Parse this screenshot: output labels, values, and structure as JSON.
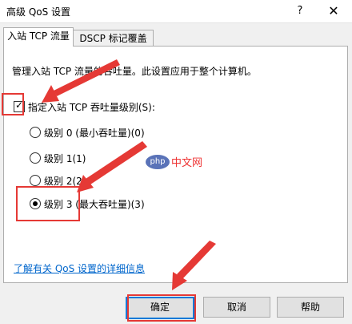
{
  "window": {
    "title": "高级 QoS 设置",
    "help_glyph": "?",
    "close_glyph": "✕"
  },
  "tabs": [
    {
      "label": "入站 TCP 流量",
      "active": true
    },
    {
      "label": "DSCP 标记覆盖",
      "active": false
    }
  ],
  "panel": {
    "description": "管理入站 TCP 流量的吞吐量。此设置应用于整个计算机。",
    "checkbox": {
      "label": "指定入站 TCP 吞吐量级别(S):",
      "checked": true
    },
    "radios": [
      {
        "label": "级别 0 (最小吞吐量)(0)",
        "checked": false
      },
      {
        "label": "级别 1(1)",
        "checked": false
      },
      {
        "label": "级别 2(2)",
        "checked": false
      },
      {
        "label": "级别 3 (最大吞吐量)(3)",
        "checked": true
      }
    ],
    "link": "了解有关 QoS 设置的详细信息"
  },
  "buttons": {
    "ok": "确定",
    "cancel": "取消",
    "help": "帮助"
  },
  "watermark": {
    "logo": "php",
    "text": "中文网"
  },
  "colors": {
    "annotation": "#e53935",
    "link": "#0066cc",
    "focus": "#0078d7"
  }
}
